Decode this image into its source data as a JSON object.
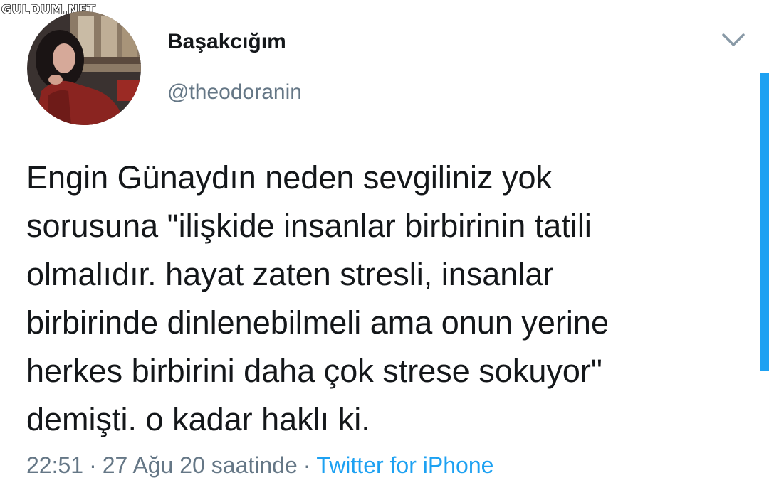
{
  "watermark": "GULDUM.NET",
  "tweet": {
    "display_name": "Başakcığım",
    "handle": "@theodoranin",
    "text": "Engin Günaydın neden sevgiliniz yok\nsorusuna \"ilişkide insanlar birbirinin tatili\nolmalıdır. hayat zaten stresli, insanlar\nbirbirinde dinlenebilmeli ama onun yerine\nherkes birbirini daha çok strese sokuyor\"\ndemişti. o kadar haklı ki.",
    "time": "22:51",
    "separator": "·",
    "date": "27 Ağu 20 saatinde",
    "source": "Twitter for iPhone"
  },
  "icons": {
    "menu": "chevron-down-icon",
    "avatar": "avatar"
  },
  "colors": {
    "text": "#14171a",
    "secondary": "#657786",
    "accent": "#1da1f2"
  }
}
